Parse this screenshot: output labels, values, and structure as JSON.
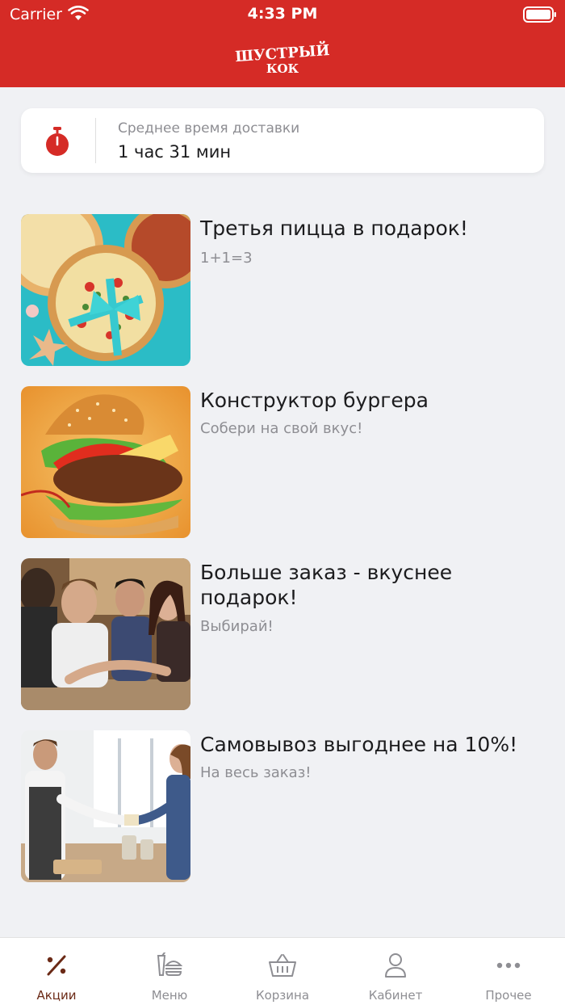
{
  "status_bar": {
    "carrier": "Carrier",
    "time": "4:33 PM"
  },
  "header": {
    "logo_line1": "ШУСТРЫЙ",
    "logo_line2": "КОК",
    "background_color": "#d52b26"
  },
  "delivery": {
    "label": "Среднее время доставки",
    "value": "1 час 31 мин",
    "icon": "stopwatch-icon",
    "icon_color": "#d52b26"
  },
  "promos": [
    {
      "title": "Третья пицца в подарок!",
      "subtitle": "1+1=3",
      "image": "pizza-promo-image"
    },
    {
      "title": "Конструктор бургера",
      "subtitle": "Собери на свой вкус!",
      "image": "burger-promo-image"
    },
    {
      "title": "Больше заказ - вкуснее подарок!",
      "subtitle": "Выбирай!",
      "image": "friends-promo-image"
    },
    {
      "title": "Самовывоз выгоднее на 10%!",
      "subtitle": "На весь заказ!",
      "image": "pickup-promo-image"
    }
  ],
  "tabs": [
    {
      "label": "Акции",
      "icon": "percent-icon",
      "active": true
    },
    {
      "label": "Меню",
      "icon": "menu-food-icon",
      "active": false
    },
    {
      "label": "Корзина",
      "icon": "basket-icon",
      "active": false
    },
    {
      "label": "Кабинет",
      "icon": "user-icon",
      "active": false
    },
    {
      "label": "Прочее",
      "icon": "more-icon",
      "active": false
    }
  ],
  "colors": {
    "accent": "#d52b26",
    "active_tab": "#6b2a16",
    "inactive_tab": "#8e8e93"
  }
}
